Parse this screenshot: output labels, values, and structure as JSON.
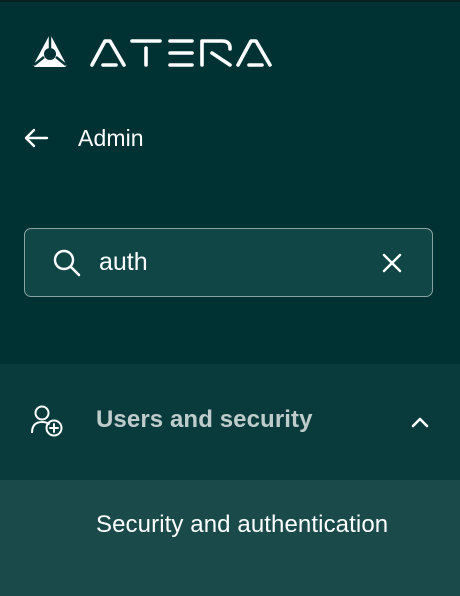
{
  "brand": {
    "name": "ATERA",
    "logo_icon": "atera-logo-icon"
  },
  "header": {
    "back_icon": "arrow-left-icon",
    "title": "Admin"
  },
  "search": {
    "value": "auth",
    "placeholder": "",
    "search_icon": "search-icon",
    "clear_icon": "close-icon"
  },
  "nav": {
    "section": {
      "label": "Users and security",
      "icon": "user-add-icon",
      "expanded": true,
      "chevron_icon": "chevron-up-icon"
    },
    "items": [
      {
        "label": "Security and authentication",
        "selected": true
      }
    ]
  },
  "colors": {
    "background": "#003233",
    "search_bg": "#114647",
    "section_bg": "#093b3c",
    "item_selected_bg": "#1a4a4a",
    "muted_text": "#bfcccc"
  }
}
